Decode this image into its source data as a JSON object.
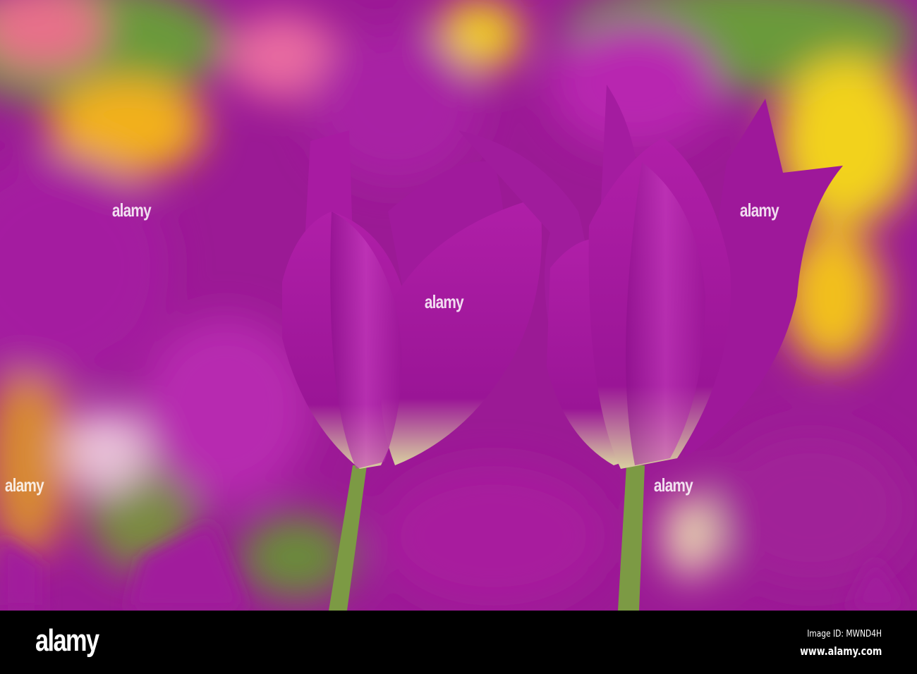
{
  "photo": {
    "subject": "purple-tulips",
    "colors": {
      "petal": "#a2169c",
      "petal_light": "#c23bbf",
      "background_yellow": "#f2c41a",
      "background_green": "#6a9a3a",
      "stem": "#7c9a44"
    }
  },
  "watermark": {
    "text": "alamy"
  },
  "footer": {
    "logo": "alamy",
    "image_id": "Image ID: MWND4H",
    "website": "www.alamy.com"
  }
}
